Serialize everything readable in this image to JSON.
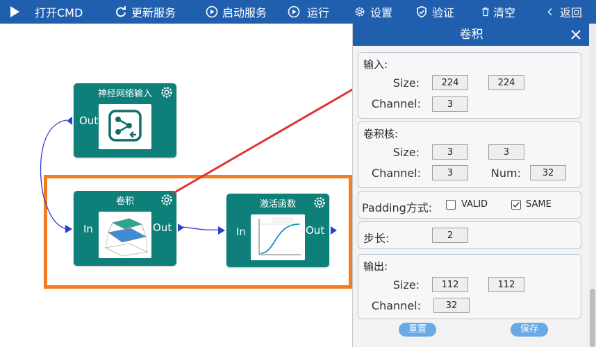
{
  "toolbar": {
    "items": [
      {
        "label": "打开CMD",
        "icon": "play-icon"
      },
      {
        "label": "更新服务",
        "icon": "refresh-icon"
      },
      {
        "label": "启动服务",
        "icon": "start-icon"
      },
      {
        "label": "运行",
        "icon": "run-icon"
      },
      {
        "label": "设置",
        "icon": "gear-icon"
      },
      {
        "label": "验证",
        "icon": "shield-icon"
      },
      {
        "label": "清空",
        "icon": "trash-icon"
      },
      {
        "label": "返回",
        "icon": "back-icon"
      }
    ]
  },
  "canvas": {
    "nodes": {
      "input": {
        "title": "神经网络输入",
        "out": "Out"
      },
      "conv": {
        "title": "卷积",
        "in": "In",
        "out": "Out"
      },
      "activation": {
        "title": "激活函数",
        "in": "In",
        "out": "Out"
      }
    }
  },
  "panel": {
    "title": "卷积",
    "input": {
      "title": "输入:",
      "size_label": "Size:",
      "size_w": "224",
      "size_h": "224",
      "channel_label": "Channel:",
      "channel": "3"
    },
    "kernel": {
      "title": "卷积核:",
      "size_label": "Size:",
      "size_w": "3",
      "size_h": "3",
      "channel_label": "Channel:",
      "channel": "3",
      "num_label": "Num:",
      "num": "32"
    },
    "padding": {
      "label": "Padding方式:",
      "valid": "VALID",
      "same": "SAME",
      "valid_checked": false,
      "same_checked": true
    },
    "stride": {
      "label": "步长:",
      "value": "2"
    },
    "output": {
      "title": "输出:",
      "size_label": "Size:",
      "size_w": "112",
      "size_h": "112",
      "channel_label": "Channel:",
      "channel": "32"
    },
    "reset_label": "重置",
    "save_label": "保存"
  },
  "colors": {
    "toolbar": "#1f5fae",
    "node": "#0f7f7a",
    "selection": "#f47c20",
    "arrow": "#e53030",
    "button": "#6aa9e6"
  }
}
